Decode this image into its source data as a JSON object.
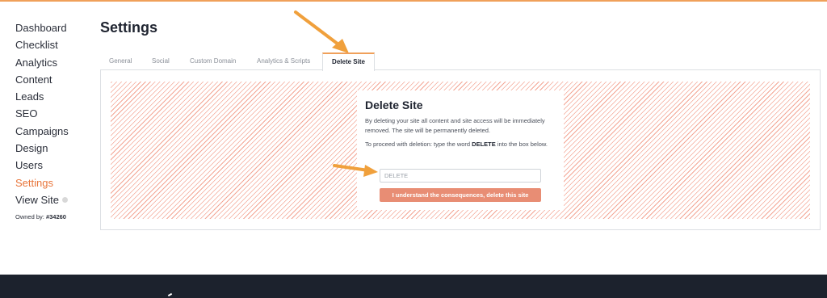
{
  "sidebar": {
    "items": [
      {
        "label": "Dashboard",
        "active": false
      },
      {
        "label": "Checklist",
        "active": false
      },
      {
        "label": "Analytics",
        "active": false
      },
      {
        "label": "Content",
        "active": false
      },
      {
        "label": "Leads",
        "active": false
      },
      {
        "label": "SEO",
        "active": false
      },
      {
        "label": "Campaigns",
        "active": false
      },
      {
        "label": "Design",
        "active": false
      },
      {
        "label": "Users",
        "active": false
      },
      {
        "label": "Settings",
        "active": true
      },
      {
        "label": "View Site",
        "active": false
      }
    ],
    "owned_prefix": "Owned by:",
    "owned_id": "#34260"
  },
  "header": {
    "title": "Settings"
  },
  "tabs": [
    {
      "label": "General",
      "active": false
    },
    {
      "label": "Social",
      "active": false
    },
    {
      "label": "Custom Domain",
      "active": false
    },
    {
      "label": "Analytics & Scripts",
      "active": false
    },
    {
      "label": "Delete Site",
      "active": true
    }
  ],
  "delete_panel": {
    "title": "Delete Site",
    "description": "By deleting your site all content and site access will be immediately removed. The site will be permanently deleted.",
    "instruction_prefix": "To proceed with deletion: type the word",
    "instruction_keyword": "DELETE",
    "instruction_suffix": "into the box below.",
    "input_placeholder": "DELETE",
    "input_value": "",
    "button_label": "I understand the consequences, delete this site"
  },
  "colors": {
    "accent": "#e8753a",
    "annotation_arrow": "#f0a03c",
    "danger_button": "#e88d74",
    "hatch": "#f3a594",
    "footer": "#1c222d"
  },
  "icons": {
    "view_site": "external-link-icon"
  }
}
